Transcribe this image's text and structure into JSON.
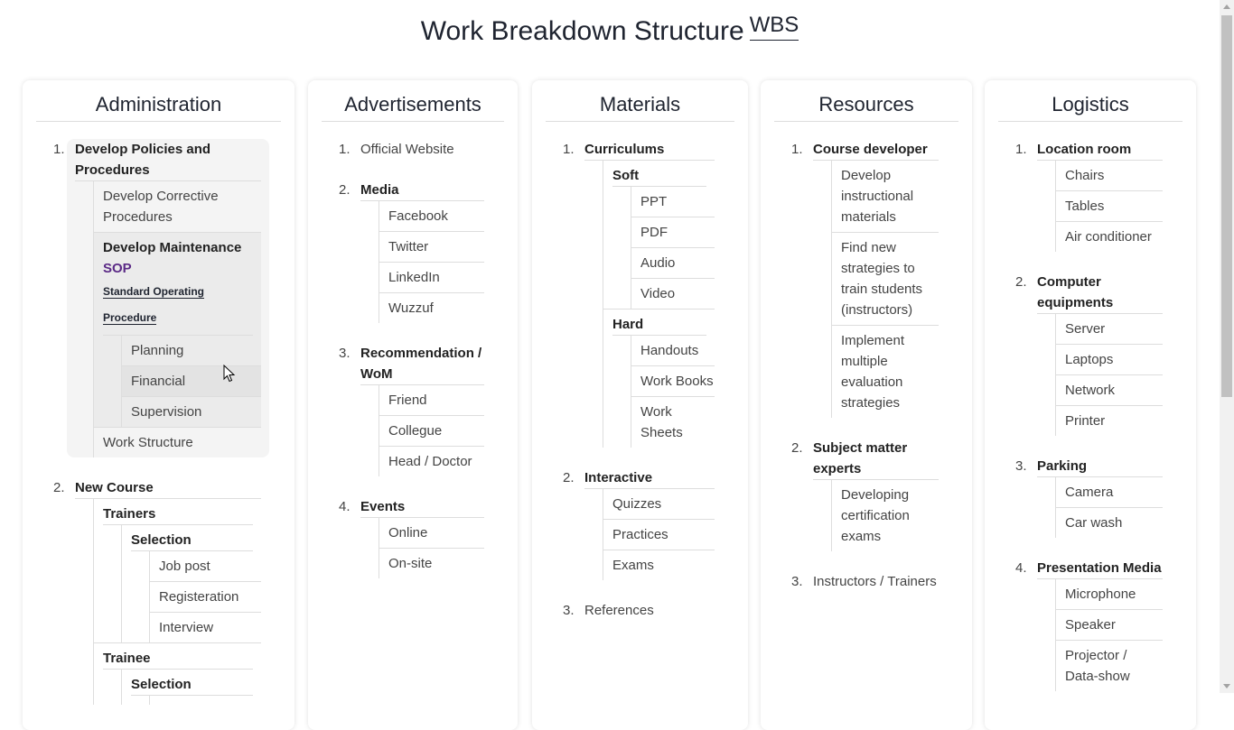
{
  "page": {
    "title": "Work Breakdown Structure",
    "abbr": "WBS"
  },
  "columns": [
    {
      "heading": "Administration",
      "items": [
        {
          "label": "Develop Policies and Procedures",
          "hovered": true,
          "children": [
            {
              "label": "Develop Corrective Procedures"
            },
            {
              "label": "Develop Maintenance",
              "sop": "SOP",
              "abbr": "Standard Operating Procedure",
              "hovered": true,
              "children": [
                {
                  "label": "Planning"
                },
                {
                  "label": "Financial",
                  "hovered": true
                },
                {
                  "label": "Supervision"
                }
              ]
            },
            {
              "label": "Work Structure"
            }
          ]
        },
        {
          "label": "New Course",
          "children": [
            {
              "label": "Trainers",
              "children": [
                {
                  "label": "Selection",
                  "children": [
                    {
                      "label": "Job post"
                    },
                    {
                      "label": "Registeration"
                    },
                    {
                      "label": "Interview"
                    }
                  ]
                }
              ]
            },
            {
              "label": "Trainee",
              "children": [
                {
                  "label": "Selection",
                  "children": [
                    {
                      "label": ""
                    }
                  ]
                }
              ]
            }
          ]
        }
      ]
    },
    {
      "heading": "Advertisements",
      "items": [
        {
          "label": "Official Website"
        },
        {
          "label": "Media",
          "children": [
            {
              "label": "Facebook"
            },
            {
              "label": "Twitter"
            },
            {
              "label": "LinkedIn"
            },
            {
              "label": "Wuzzuf"
            }
          ]
        },
        {
          "label": "Recommendation / WoM",
          "children": [
            {
              "label": "Friend"
            },
            {
              "label": "Collegue"
            },
            {
              "label": "Head / Doctor"
            }
          ]
        },
        {
          "label": "Events",
          "children": [
            {
              "label": "Online"
            },
            {
              "label": "On-site"
            }
          ]
        }
      ]
    },
    {
      "heading": "Materials",
      "items": [
        {
          "label": "Curriculums",
          "children": [
            {
              "label": "Soft",
              "children": [
                {
                  "label": "PPT"
                },
                {
                  "label": "PDF"
                },
                {
                  "label": "Audio"
                },
                {
                  "label": "Video"
                }
              ]
            },
            {
              "label": "Hard",
              "children": [
                {
                  "label": "Handouts"
                },
                {
                  "label": "Work Books"
                },
                {
                  "label": "Work Sheets"
                }
              ]
            }
          ]
        },
        {
          "label": "Interactive",
          "children": [
            {
              "label": "Quizzes"
            },
            {
              "label": "Practices"
            },
            {
              "label": "Exams"
            }
          ]
        },
        {
          "label": "References"
        }
      ]
    },
    {
      "heading": "Resources",
      "items": [
        {
          "label": "Course developer",
          "children": [
            {
              "label": "Develop instructional materials"
            },
            {
              "label": "Find new strategies to train students (instructors)"
            },
            {
              "label": "Implement multiple evaluation strategies"
            }
          ]
        },
        {
          "label": "Subject matter experts",
          "children": [
            {
              "label": "Developing certification exams"
            }
          ]
        },
        {
          "label": "Instructors / Trainers"
        }
      ]
    },
    {
      "heading": "Logistics",
      "items": [
        {
          "label": "Location room",
          "children": [
            {
              "label": "Chairs"
            },
            {
              "label": "Tables"
            },
            {
              "label": "Air conditioner"
            }
          ]
        },
        {
          "label": "Computer equipments",
          "children": [
            {
              "label": "Server"
            },
            {
              "label": "Laptops"
            },
            {
              "label": "Network"
            },
            {
              "label": "Printer"
            }
          ]
        },
        {
          "label": "Parking",
          "children": [
            {
              "label": "Camera"
            },
            {
              "label": "Car wash"
            }
          ]
        },
        {
          "label": "Presentation Media",
          "children": [
            {
              "label": "Microphone"
            },
            {
              "label": "Speaker"
            },
            {
              "label": "Projector / Data-show"
            }
          ]
        }
      ]
    }
  ]
}
